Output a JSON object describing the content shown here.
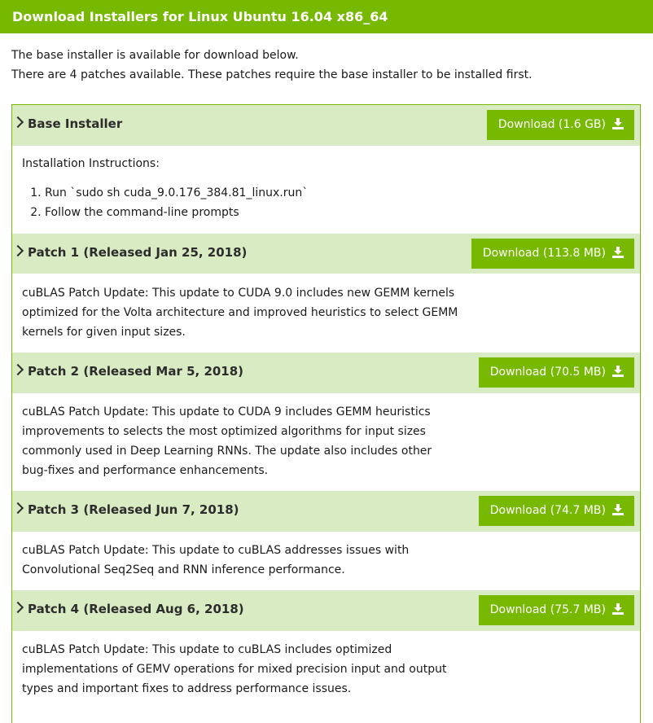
{
  "header": {
    "title": "Download Installers for Linux Ubuntu 16.04 x86_64"
  },
  "intro": {
    "line1": "The base installer is available for download below.",
    "line2": "There are 4 patches available. These patches require the base installer to be installed first."
  },
  "colors": {
    "accent": "#76b900",
    "section_bg": "#d9ebc3"
  },
  "sections": [
    {
      "title": "Base Installer",
      "download_label": "Download (1.6 GB)",
      "instructions_heading": "Installation Instructions:",
      "steps": [
        "Run `sudo sh cuda_9.0.176_384.81_linux.run`",
        "Follow the command-line prompts"
      ]
    },
    {
      "title": "Patch 1 (Released Jan 25, 2018)",
      "download_label": "Download (113.8 MB)",
      "lines": [
        "cuBLAS Patch Update: This update to CUDA 9.0 includes new GEMM kernels",
        "optimized for the Volta architecture and improved heuristics to select GEMM",
        "kernels for given input sizes."
      ]
    },
    {
      "title": "Patch 2 (Released Mar 5, 2018)",
      "download_label": "Download (70.5 MB)",
      "lines": [
        "cuBLAS Patch Update: This update to CUDA 9 includes GEMM heuristics",
        "improvements to selects the most optimized algorithms for input sizes",
        "commonly used in Deep Learning RNNs. The update also includes other",
        "bug-fixes and performance enhancements."
      ]
    },
    {
      "title": "Patch 3 (Released Jun 7, 2018)",
      "download_label": "Download (74.7 MB)",
      "lines": [
        "cuBLAS Patch Update: This update to cuBLAS addresses issues with",
        "Convolutional Seq2Seq and RNN inference performance."
      ]
    },
    {
      "title": "Patch 4 (Released Aug 6, 2018)",
      "download_label": "Download (75.7 MB)",
      "lines": [
        "cuBLAS Patch Update: This update to cuBLAS includes optimized",
        "implementations of GEMV operations for mixed precision input and output",
        "types and important fixes to address performance issues."
      ]
    }
  ],
  "icons": {
    "chevron": "chevron-right-icon",
    "download": "download-icon"
  }
}
